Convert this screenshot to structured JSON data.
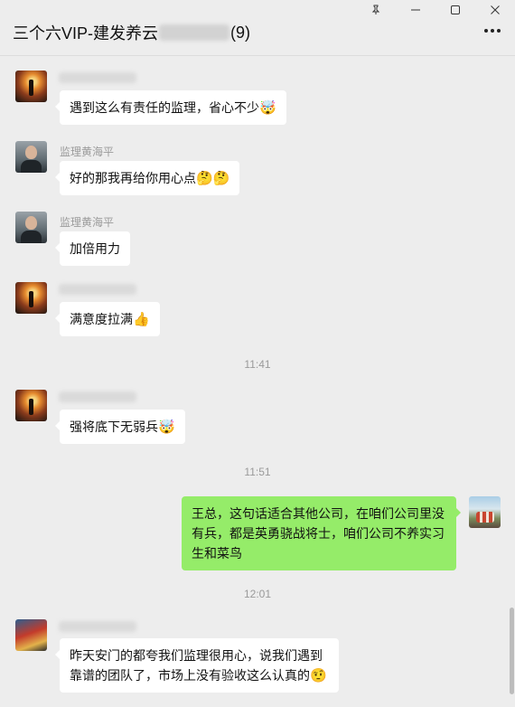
{
  "window": {
    "title_prefix": "三个六VIP-建发养云",
    "title_suffix": "(9)",
    "controls": [
      "pin-icon",
      "minimize-icon",
      "maximize-icon",
      "close-icon"
    ]
  },
  "messages": [
    {
      "sender": "",
      "avatar": "sunset-avatar",
      "text": "遇到这么有责任的监理，省心不少",
      "emoji": "🤯"
    },
    {
      "sender": "监理黄海平",
      "avatar": "man-avatar",
      "text": "好的那我再给你用心点",
      "emoji": "🤔🤔"
    },
    {
      "sender": "监理黄海平",
      "avatar": "man-avatar",
      "text": "加倍用力",
      "emoji": ""
    },
    {
      "sender": "",
      "avatar": "sunset-avatar",
      "text": "满意度拉满",
      "emoji": "👍"
    },
    {
      "sender": "",
      "avatar": "sunset-avatar",
      "text": "强将底下无弱兵",
      "emoji": "🤯"
    },
    {
      "sender": "",
      "avatar": "group-avatar",
      "text": "王总，这句话适合其他公司，在咱们公司里没有兵，都是英勇骁战将士，咱们公司不养实习生和菜鸟",
      "emoji": ""
    },
    {
      "sender": "",
      "avatar": "bike-avatar",
      "text_line1": "昨天安门的都夸我们监理很用心，说我们遇到",
      "text_line2": "靠谱的团队了，市场上没有验收这么认真的",
      "emoji": "🤨"
    }
  ],
  "timestamps": [
    "11:41",
    "11:51",
    "12:01"
  ],
  "colors": {
    "own_bubble": "#95ec69",
    "other_bubble": "#ffffff",
    "background": "#ededed"
  }
}
